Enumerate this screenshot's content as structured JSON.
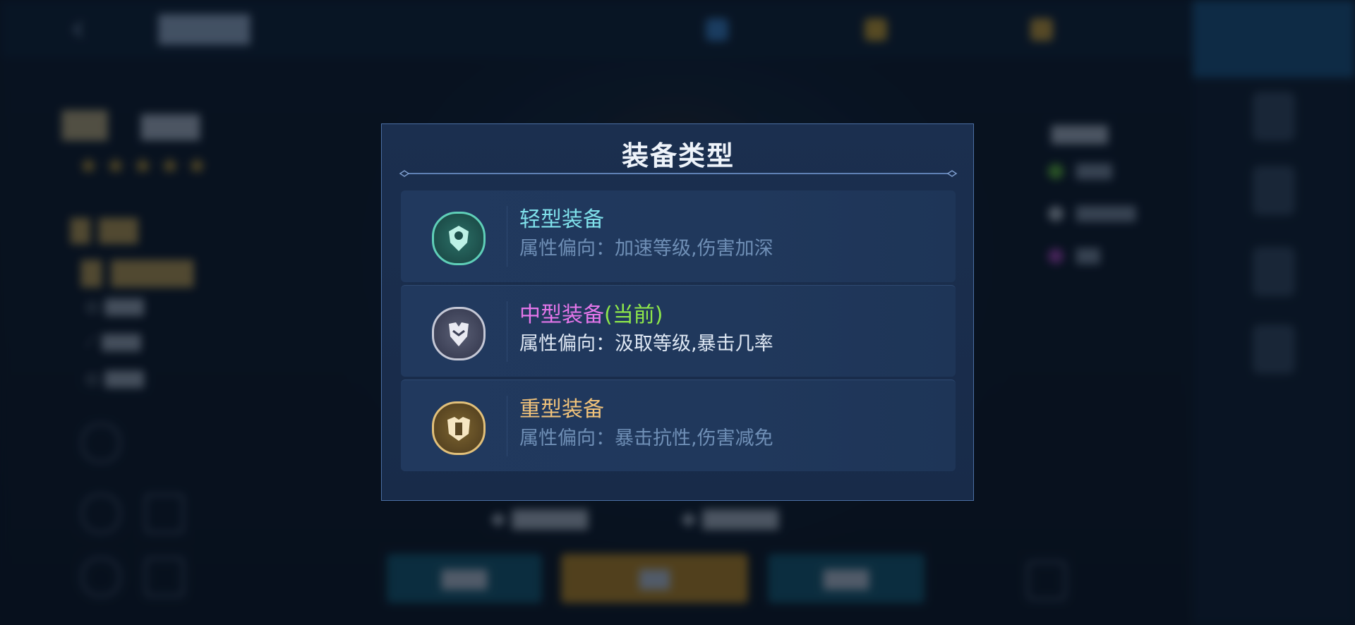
{
  "modal": {
    "title": "装备类型",
    "options": [
      {
        "name": "轻型装备",
        "current_tag": "",
        "attr_label": "属性偏向：",
        "attr_value": "加速等级,伤害加深",
        "name_color": "#7fe0ea",
        "attr_color": "#6f8fb6",
        "icon": "light-armor-icon"
      },
      {
        "name": "中型装备",
        "current_tag": "(当前)",
        "attr_label": "属性偏向：",
        "attr_value": "汲取等级,暴击几率",
        "name_color": "#e476ea",
        "current_color": "#8ee84a",
        "attr_color": "#dfe8f4",
        "icon": "medium-armor-icon"
      },
      {
        "name": "重型装备",
        "current_tag": "",
        "attr_label": "属性偏向：",
        "attr_value": "暴击抗性,伤害减免",
        "name_color": "#f0c27a",
        "attr_color": "#6f8fb6",
        "icon": "heavy-armor-icon"
      }
    ]
  },
  "colors": {
    "modal_bg": "#1b2f4f",
    "modal_border": "#4b6fa4",
    "option_bg": "#21395e"
  }
}
